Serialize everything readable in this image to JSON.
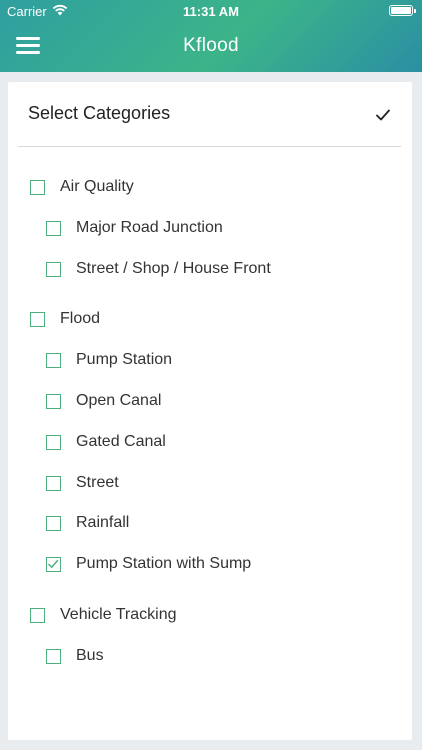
{
  "status_bar": {
    "carrier": "Carrier",
    "time": "11:31 AM"
  },
  "nav": {
    "title": "Kflood"
  },
  "panel": {
    "title": "Select Categories"
  },
  "categories": [
    {
      "label": "Air Quality",
      "checked": false,
      "children": [
        {
          "label": "Major Road Junction",
          "checked": false
        },
        {
          "label": "Street / Shop / House Front",
          "checked": false
        }
      ]
    },
    {
      "label": "Flood",
      "checked": false,
      "children": [
        {
          "label": "Pump Station",
          "checked": false
        },
        {
          "label": "Open Canal",
          "checked": false
        },
        {
          "label": "Gated Canal",
          "checked": false
        },
        {
          "label": "Street",
          "checked": false
        },
        {
          "label": "Rainfall",
          "checked": false
        },
        {
          "label": "Pump Station with Sump",
          "checked": true
        }
      ]
    },
    {
      "label": "Vehicle Tracking",
      "checked": false,
      "children": [
        {
          "label": "Bus",
          "checked": false
        }
      ]
    }
  ],
  "colors": {
    "accent": "#4caf7d",
    "header_start": "#2f9fa0",
    "header_end": "#2a8fa3"
  }
}
